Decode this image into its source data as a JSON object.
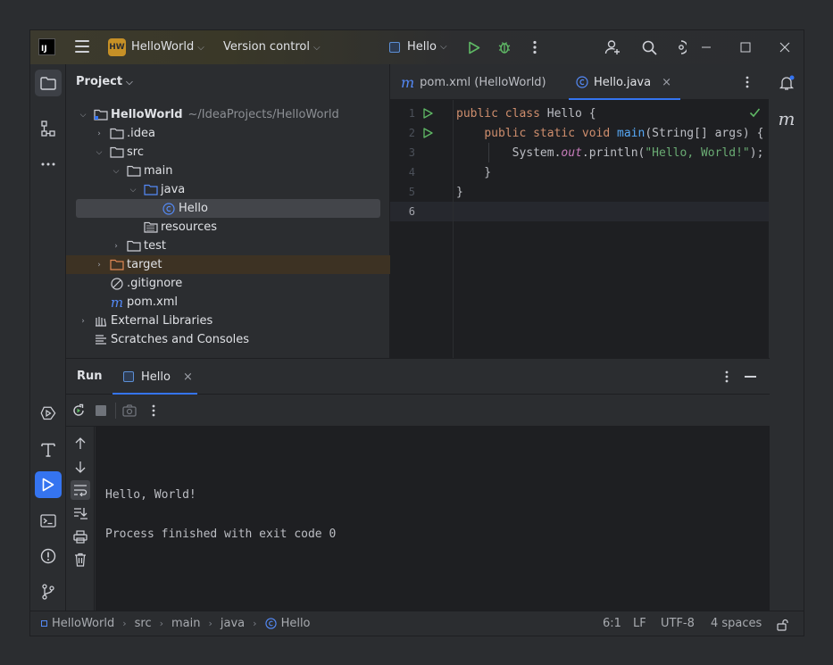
{
  "titlebar": {
    "logo": "IJ",
    "project_badge": "HW",
    "project_name": "HelloWorld",
    "vcs_label": "Version control",
    "run_config": "Hello",
    "colors": {
      "accent": "#3574f0",
      "run_green": "#5fb865",
      "badge": "#c69026"
    }
  },
  "project": {
    "header": "Project",
    "tree": [
      {
        "label": "HelloWorld",
        "hint": "~/IdeaProjects/HelloWorld",
        "icon": "module-folder-icon"
      },
      {
        "label": ".idea",
        "icon": "folder-icon"
      },
      {
        "label": "src",
        "icon": "folder-icon"
      },
      {
        "label": "main",
        "icon": "folder-icon"
      },
      {
        "label": "java",
        "icon": "source-folder-icon"
      },
      {
        "label": "Hello",
        "icon": "class-icon"
      },
      {
        "label": "resources",
        "icon": "resources-folder-icon"
      },
      {
        "label": "test",
        "icon": "folder-icon"
      },
      {
        "label": "target",
        "icon": "excluded-folder-icon"
      },
      {
        "label": ".gitignore",
        "icon": "ignored-file-icon"
      },
      {
        "label": "pom.xml",
        "icon": "maven-icon"
      },
      {
        "label": "External Libraries",
        "icon": "libraries-icon"
      },
      {
        "label": "Scratches and Consoles",
        "icon": "scratches-icon"
      }
    ]
  },
  "editor": {
    "tabs": [
      {
        "label": "pom.xml (HelloWorld)",
        "icon": "maven-icon"
      },
      {
        "label": "Hello.java",
        "icon": "class-icon"
      }
    ],
    "line_numbers": [
      "1",
      "2",
      "3",
      "4",
      "5",
      "6"
    ],
    "code": {
      "l1_kw": "public class ",
      "l1_rest": "Hello {",
      "l2_indent": "    ",
      "l2_kw": "public static void ",
      "l2_fn": "main",
      "l2_rest": "(String[] args) {",
      "l3_indent": "        ",
      "l3_a": "System.",
      "l3_field": "out",
      "l3_b": ".println(",
      "l3_str": "\"Hello, World!\"",
      "l3_c": ");",
      "l4": "    }",
      "l5": "}"
    }
  },
  "run": {
    "title": "Run",
    "tab": "Hello",
    "output": [
      "Hello, World!",
      "Process finished with exit code 0"
    ]
  },
  "statusbar": {
    "breadcrumb": [
      "HelloWorld",
      "src",
      "main",
      "java",
      "Hello"
    ],
    "position": "6:1",
    "line_sep": "LF",
    "encoding": "UTF-8",
    "indent": "4 spaces"
  }
}
